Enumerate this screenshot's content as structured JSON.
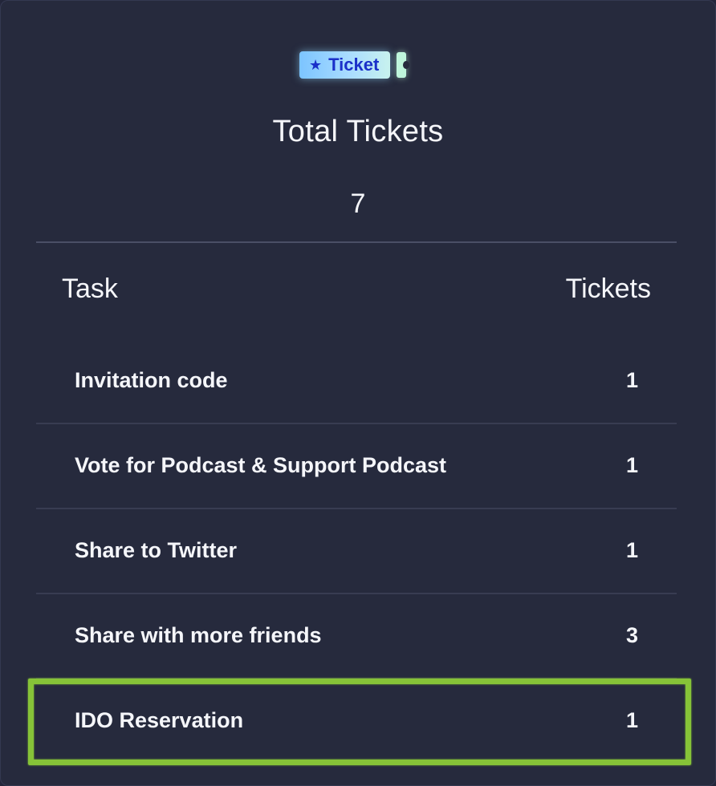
{
  "badge": {
    "label": "Ticket",
    "icon": "star-icon",
    "color": "#1a30c9"
  },
  "summary": {
    "title": "Total Tickets",
    "total": "7"
  },
  "table": {
    "headers": {
      "task": "Task",
      "tickets": "Tickets"
    },
    "rows": [
      {
        "task": "Invitation code",
        "tickets": "1"
      },
      {
        "task": "Vote for Podcast & Support Podcast",
        "tickets": "1"
      },
      {
        "task": "Share to Twitter",
        "tickets": "1"
      },
      {
        "task": "Share with more friends",
        "tickets": "3"
      },
      {
        "task": "IDO Reservation",
        "tickets": "1",
        "highlighted": true
      }
    ]
  },
  "colors": {
    "background": "#262a3d",
    "highlight": "#86c338"
  }
}
